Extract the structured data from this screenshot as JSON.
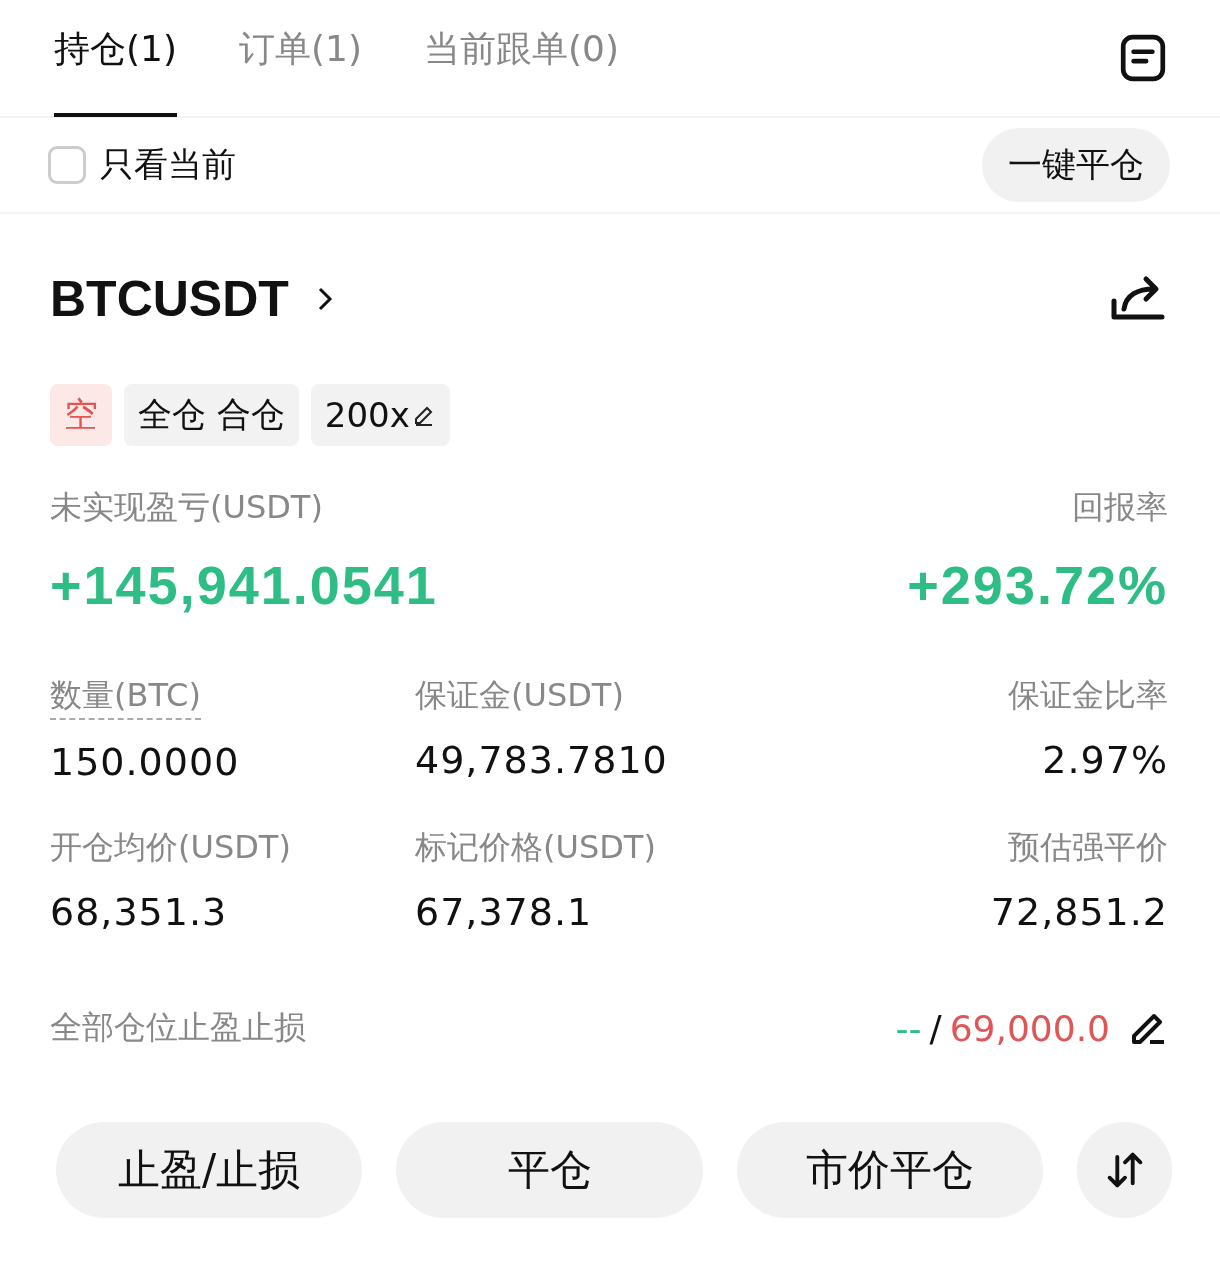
{
  "tabs": [
    {
      "label": "持仓(1)",
      "selected": true
    },
    {
      "label": "订单(1)",
      "selected": false
    },
    {
      "label": "当前跟单(0)",
      "selected": false
    }
  ],
  "filter": {
    "label": "只看当前",
    "checked": false
  },
  "close_all_button": "一键平仓",
  "position": {
    "symbol": "BTCUSDT",
    "tags": [
      {
        "kind": "side",
        "label": "空"
      },
      {
        "kind": "mode",
        "label": "全仓 合仓"
      },
      {
        "kind": "leverage",
        "label": "200x"
      }
    ],
    "pnl": {
      "label": "未实现盈亏(USDT)",
      "value": "+145,941.0541"
    },
    "roe": {
      "label": "回报率",
      "value": "+293.72%"
    },
    "fields": [
      {
        "label": "数量(BTC)",
        "value": "150.0000",
        "dashed": true
      },
      {
        "label": "保证金(USDT)",
        "value": "49,783.7810",
        "dashed": false
      },
      {
        "label": "保证金比率",
        "value": "2.97%",
        "dashed": false
      },
      {
        "label": "开仓均价(USDT)",
        "value": "68,351.3",
        "dashed": false
      },
      {
        "label": "标记价格(USDT)",
        "value": "67,378.1",
        "dashed": false
      },
      {
        "label": "预估强平价",
        "value": "72,851.2",
        "dashed": false
      }
    ],
    "tpsl": {
      "label": "全部仓位止盈止损",
      "take_profit": "--",
      "separator": "/",
      "stop_loss": "69,000.0"
    }
  },
  "buttons": [
    "止盈/止损",
    "平仓",
    "市价平仓"
  ]
}
